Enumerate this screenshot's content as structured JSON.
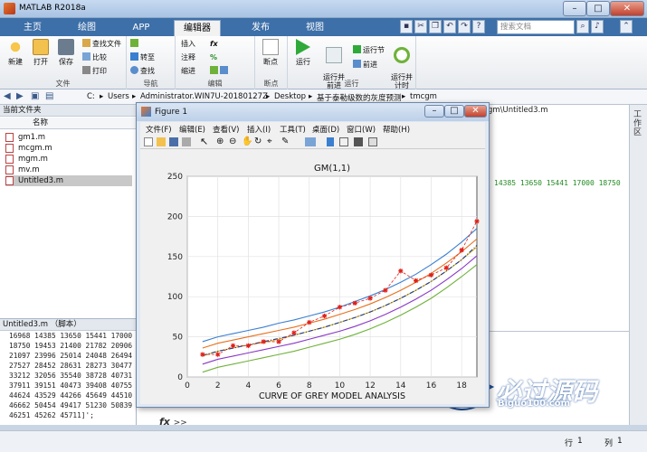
{
  "window": {
    "title": "MATLAB R2018a",
    "minimize": "–",
    "maximize": "□",
    "close": "✕"
  },
  "tabs": [
    {
      "label": "主页"
    },
    {
      "label": "绘图"
    },
    {
      "label": "APP"
    },
    {
      "label": "编辑器"
    },
    {
      "label": "发布"
    },
    {
      "label": "视图"
    }
  ],
  "search": {
    "placeholder": "搜索文档"
  },
  "ribbon": {
    "file": {
      "group": "文件",
      "new": "新建",
      "open": "打开",
      "save": "保存",
      "find_files": "查找文件",
      "compare": "比较",
      "print": "打印"
    },
    "nav": {
      "group": "导航",
      "goto": "转至",
      "find": "查找"
    },
    "edit": {
      "group": "编辑",
      "insert": "插入",
      "comment": "注释",
      "indent": "缩进",
      "fx": "fx"
    },
    "breakpoints": {
      "group": "断点",
      "label": "断点"
    },
    "run": {
      "group": "运行",
      "run": "运行",
      "run_advance": "运行并\n前进",
      "run_section": "运行节",
      "advance": "前进",
      "run_time": "运行并\n计时"
    }
  },
  "address": {
    "crumbs": [
      "C:",
      "Users",
      "Administrator.WIN7U-20180127Z",
      "Desktop",
      "基于泰勒级数的灰度预测",
      "tmcgm"
    ]
  },
  "current_folder": {
    "header": "当前文件夹",
    "column": "名称",
    "files": [
      {
        "name": "gm1.m",
        "selected": false
      },
      {
        "name": "mcgm.m",
        "selected": false
      },
      {
        "name": "mgm.m",
        "selected": false
      },
      {
        "name": "mv.m",
        "selected": false
      },
      {
        "name": "Untitled3.m",
        "selected": true
      }
    ]
  },
  "details": {
    "header": "Untitled3.m （脚本）",
    "lines": [
      "16968 14385 13650 15441 17000",
      "18750 19453 21400 21782 20906",
      "21097 23996 25014 24048 26494",
      "27527 28452 28631 28273 30477",
      "33212 32056 35540 38728 40731",
      "37911 39151 40473 39408 40755",
      "44624 43529 44266 45649 44510",
      "46662 50454 49417 51230 50839",
      "46251 45262 45711]';"
    ]
  },
  "editor": {
    "tab": "gm\\Untitled3.m",
    "visible_code": "14385 13650 15441 17000 18750"
  },
  "command": {
    "fx": "fx",
    "prompt": ">>"
  },
  "sidebar": {
    "label": "工作区"
  },
  "status": {
    "row_label": "行",
    "row": "1",
    "col_label": "列",
    "col": "1"
  },
  "figure": {
    "title": "Figure 1",
    "menus": [
      "文件(F)",
      "编辑(E)",
      "查看(V)",
      "插入(I)",
      "工具(T)",
      "桌面(D)",
      "窗口(W)",
      "帮助(H)"
    ]
  },
  "watermark": {
    "text": "必过源码",
    "sub": "Biguo100.com"
  },
  "colors": {
    "tab_bar": "#3d6fa8",
    "series_blue": "#3a7fd0",
    "series_orange": "#e6701e",
    "series_yellow": "#d9b428",
    "series_purple": "#8a38c6",
    "series_green": "#6fb23a",
    "series_red": "#e0201a",
    "series_navy": "#1e3a8c"
  },
  "chart_data": {
    "type": "line",
    "title": "GM(1,1)",
    "xlabel": "CURVE OF GREY MODEL ANALYSIS",
    "ylabel": "",
    "xlim": [
      0,
      19
    ],
    "ylim": [
      0,
      250
    ],
    "xticks": [
      0,
      2,
      4,
      6,
      8,
      10,
      12,
      14,
      16,
      18
    ],
    "yticks": [
      0,
      50,
      100,
      150,
      200,
      250
    ],
    "grid": true,
    "x": [
      1,
      2,
      3,
      4,
      5,
      6,
      7,
      8,
      9,
      10,
      11,
      12,
      13,
      14,
      15,
      16,
      17,
      18,
      19
    ],
    "series": [
      {
        "color": "#3a7fd0",
        "style": "solid",
        "values": [
          44,
          50,
          54,
          58,
          62,
          67,
          71,
          76,
          81,
          87,
          94,
          101,
          109,
          118,
          128,
          140,
          153,
          168,
          185
        ]
      },
      {
        "color": "#e6701e",
        "style": "solid",
        "values": [
          36,
          42,
          46,
          50,
          54,
          58,
          62,
          67,
          72,
          78,
          84,
          91,
          99,
          108,
          118,
          129,
          142,
          156,
          172
        ]
      },
      {
        "color": "#d9b428",
        "style": "solid",
        "values": [
          26,
          32,
          36,
          40,
          43,
          47,
          52,
          57,
          62,
          68,
          74,
          81,
          89,
          98,
          108,
          119,
          132,
          146,
          162
        ]
      },
      {
        "color": "#8a38c6",
        "style": "solid",
        "values": [
          16,
          22,
          26,
          30,
          34,
          38,
          42,
          47,
          52,
          57,
          63,
          70,
          78,
          87,
          97,
          108,
          121,
          135,
          151
        ]
      },
      {
        "color": "#6fb23a",
        "style": "solid",
        "values": [
          6,
          12,
          16,
          20,
          24,
          28,
          32,
          37,
          42,
          47,
          53,
          60,
          68,
          77,
          87,
          98,
          111,
          125,
          140
        ]
      },
      {
        "color": "#1e3a8c",
        "style": "dashdot",
        "values": [
          27,
          32,
          36,
          40,
          44,
          48,
          52,
          57,
          62,
          68,
          74,
          81,
          89,
          98,
          108,
          119,
          132,
          146,
          164
        ]
      },
      {
        "color": "#e0201a",
        "style": "markers",
        "values": [
          28,
          28,
          39,
          39,
          44,
          44,
          55,
          68,
          76,
          87,
          92,
          98,
          108,
          132,
          120,
          127,
          136,
          158,
          194
        ]
      }
    ]
  }
}
